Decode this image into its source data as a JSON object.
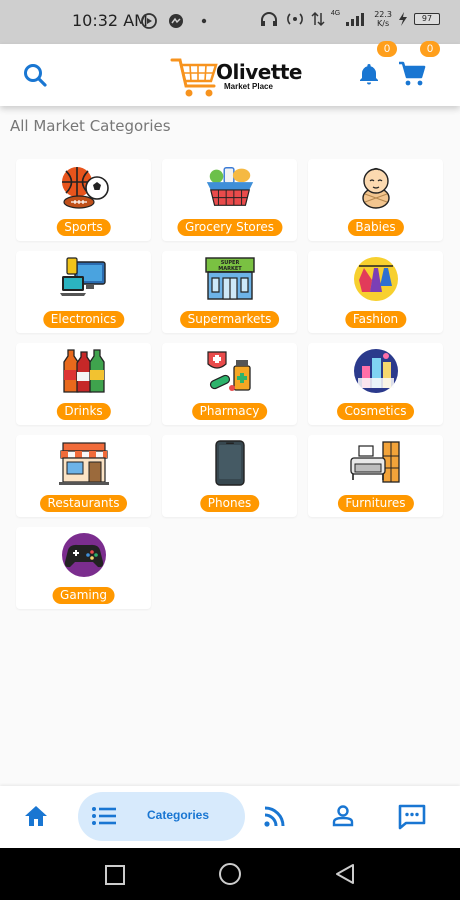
{
  "status": {
    "time": "10:32 AM",
    "net_speed_value": "22.3",
    "net_speed_unit": "K/s",
    "battery": "97",
    "signal_label": "4G"
  },
  "header": {
    "brand": "Olivette",
    "brand_sub": "Market Place",
    "notifications_count": "0",
    "cart_count": "0"
  },
  "section_title": "All Market Categories",
  "categories": [
    {
      "label": "Sports",
      "icon": "sports-balls-icon"
    },
    {
      "label": "Grocery Stores",
      "icon": "grocery-basket-icon"
    },
    {
      "label": "Babies",
      "icon": "baby-icon"
    },
    {
      "label": "Electronics",
      "icon": "electronics-icon"
    },
    {
      "label": "Supermarkets",
      "icon": "supermarket-store-icon"
    },
    {
      "label": "Fashion",
      "icon": "clothes-rack-icon"
    },
    {
      "label": "Drinks",
      "icon": "bottles-icon"
    },
    {
      "label": "Pharmacy",
      "icon": "medicine-icon"
    },
    {
      "label": "Cosmetics",
      "icon": "cosmetics-icon"
    },
    {
      "label": "Restaurants",
      "icon": "restaurant-icon"
    },
    {
      "label": "Phones",
      "icon": "smartphone-icon"
    },
    {
      "label": "Furnitures",
      "icon": "furniture-icon"
    },
    {
      "label": "Gaming",
      "icon": "gamepad-icon"
    }
  ],
  "bottom_nav": {
    "active_label": "Categories"
  },
  "colors": {
    "accent_blue": "#1976d2",
    "badge_orange": "#ff9800",
    "active_pill": "#d7eafc"
  }
}
